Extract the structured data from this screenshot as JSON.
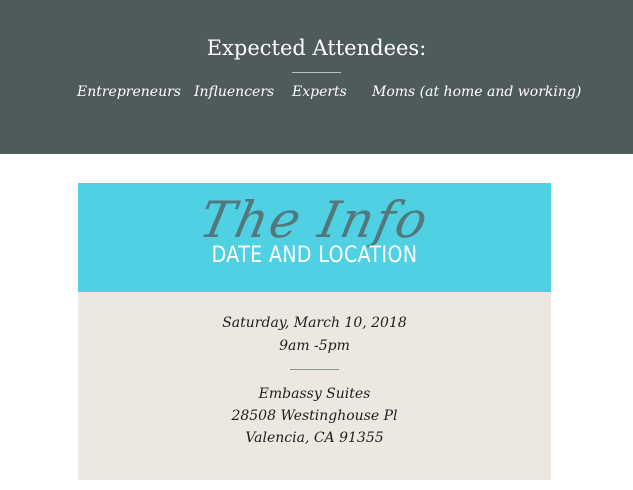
{
  "attendees": {
    "title": "Expected Attendees:",
    "items": [
      "Entrepreneurs",
      "Influencers",
      "Experts",
      "Moms (at home and working)"
    ]
  },
  "info": {
    "script_title": "The Info",
    "title": "DATE AND LOCATION",
    "date": "Saturday, March 10, 2018",
    "time": "9am -5pm",
    "venue": "Embassy Suites",
    "street": "28508 Westinghouse Pl",
    "city": "Valencia, CA  91355"
  },
  "colors": {
    "attendees_band": "#4e5b5c",
    "card_header": "#4fd0e3",
    "card_body": "#ece7e0",
    "script_title": "#55686a"
  }
}
